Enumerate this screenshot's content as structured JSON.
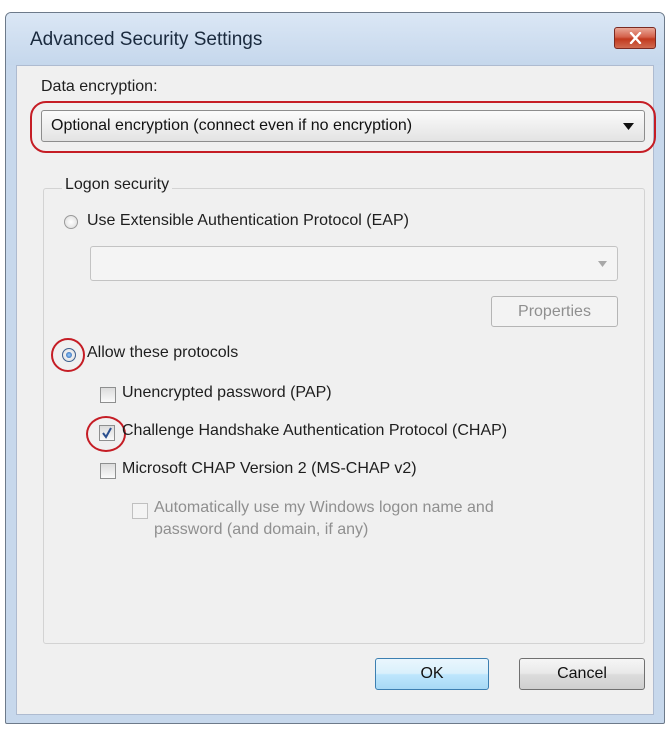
{
  "window": {
    "title": "Advanced Security Settings"
  },
  "encryption": {
    "label": "Data encryption:",
    "selected": "Optional encryption (connect even if no encryption)"
  },
  "logon": {
    "group_label": "Logon security",
    "eap_option": "Use Extensible Authentication Protocol (EAP)",
    "eap_combo_value": "",
    "properties_button": "Properties",
    "allow_option": "Allow these protocols",
    "protocols": [
      {
        "label": "Unencrypted password (PAP)",
        "checked": false
      },
      {
        "label": "Challenge Handshake Authentication Protocol (CHAP)",
        "checked": true
      },
      {
        "label": "Microsoft CHAP Version 2 (MS-CHAP v2)",
        "checked": false
      }
    ],
    "auto_logon_line1": "Automatically use my Windows logon name and",
    "auto_logon_line2": "password (and domain, if any)"
  },
  "buttons": {
    "ok": "OK",
    "cancel": "Cancel"
  },
  "colors": {
    "highlight": "#c51d25",
    "client_bg": "#f0f0f0",
    "frame": "#c7d8ec"
  },
  "icons": [
    "close-icon",
    "dropdown-arrow-icon",
    "checkmark-icon"
  ]
}
